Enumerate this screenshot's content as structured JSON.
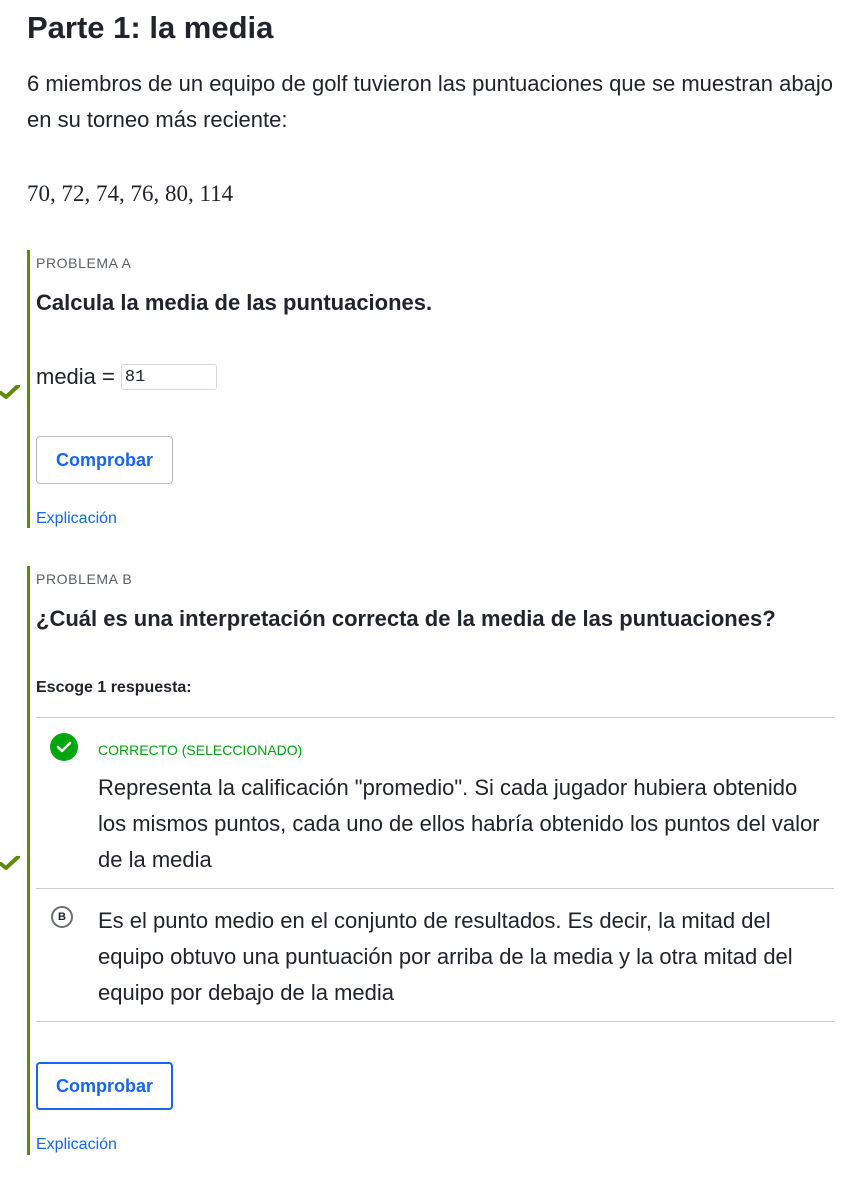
{
  "part_title": "Parte 1: la media",
  "intro_text": "6 miembros de un equipo de golf tuvieron las puntuaciones que se muestran abajo en su torneo más reciente:",
  "scores_text": "70, 72, 74, 76, 80, 114",
  "problem_a": {
    "label": "PROBLEMA A",
    "question": "Calcula la media de las puntuaciones.",
    "field_label": "media =",
    "field_value": "81",
    "check_button": "Comprobar",
    "explanation_link": "Explicación",
    "status_icon": "checkmark-icon"
  },
  "problem_b": {
    "label": "PROBLEMA B",
    "question": "¿Cuál es una interpretación correcta de la media de las puntuaciones?",
    "choose_label": "Escoge 1 respuesta:",
    "options": [
      {
        "status": "CORRECTO (SELECCIONADO)",
        "text": "Representa la calificación \"promedio\". Si cada jugador hubiera obtenido los mismos puntos, cada uno de ellos habría obtenido los puntos del valor de la media",
        "icon": "checkmark-circle-icon"
      },
      {
        "letter": "B",
        "text": "Es el punto medio en el conjunto de resultados. Es decir, la mitad del equipo obtuvo una puntuación por arriba de la media y la otra mitad del equipo por debajo de la media"
      }
    ],
    "check_button": "Comprobar",
    "explanation_link": "Explicación",
    "status_icon": "checkmark-icon"
  },
  "colors": {
    "accent_blue": "#1865f2",
    "correct_green": "#00a60e",
    "border_green": "#5e8b00",
    "text": "#21242c"
  }
}
